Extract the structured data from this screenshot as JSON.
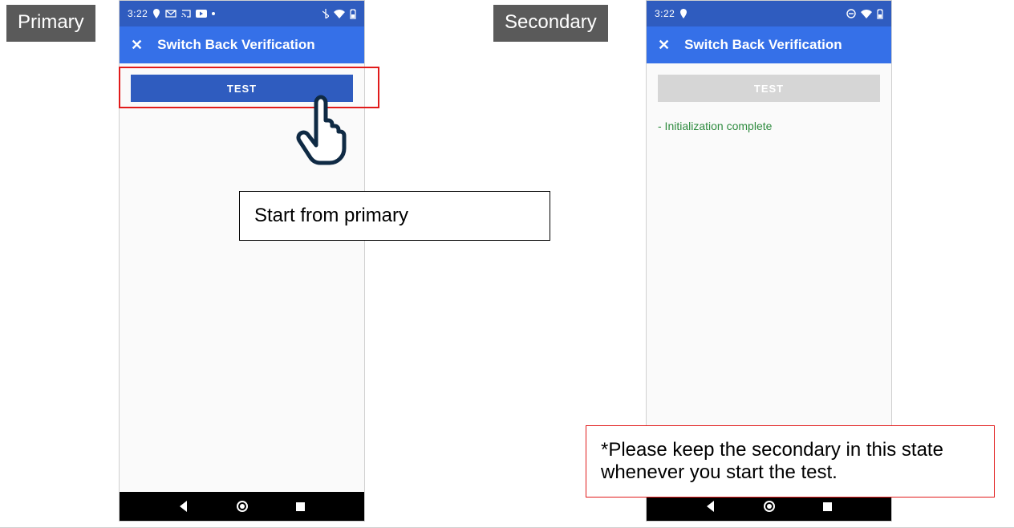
{
  "labels": {
    "primary": "Primary",
    "secondary": "Secondary"
  },
  "statusbar": {
    "time": "3:22"
  },
  "appbar": {
    "close": "✕",
    "title": "Switch Back Verification"
  },
  "buttons": {
    "test": "TEST"
  },
  "secondary_status": "- Initialization complete",
  "captions": {
    "primary": "Start from primary",
    "secondary": "*Please keep the secondary in this state whenever you start the test."
  }
}
